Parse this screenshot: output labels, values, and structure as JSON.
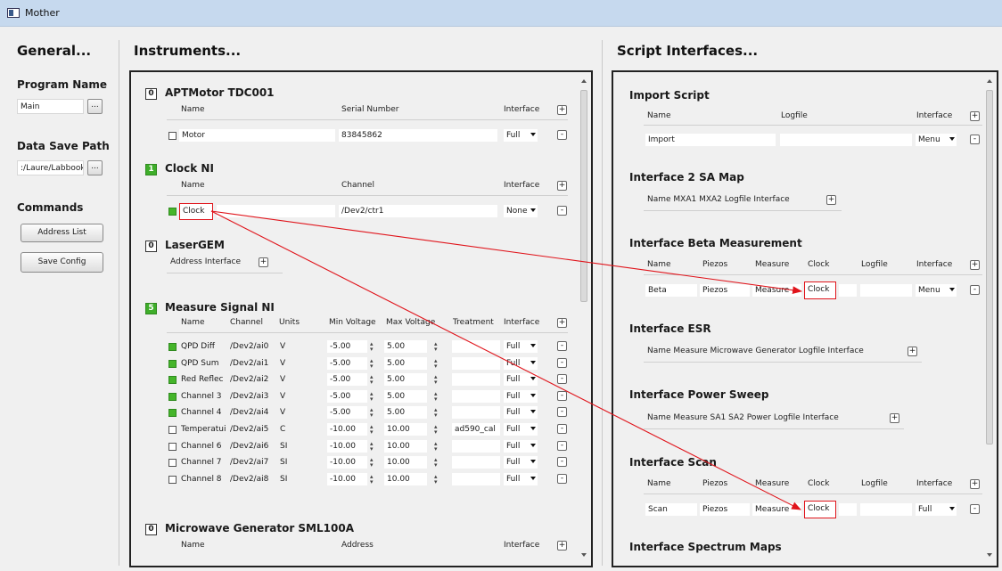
{
  "window": {
    "title": "Mother"
  },
  "general": {
    "heading": "General...",
    "program_name_label": "Program Name",
    "program_name_value": "Main",
    "data_save_path_label": "Data Save Path",
    "data_save_path_value": ":/Laure/Labbook",
    "browse_label": "...",
    "commands_label": "Commands",
    "address_list_label": "Address List",
    "save_config_label": "Save Config"
  },
  "instruments": {
    "heading": "Instruments...",
    "apt": {
      "badge": "0",
      "title": "APTMotor TDC001",
      "headers": [
        "Name",
        "Serial Number",
        "Interface"
      ],
      "row": {
        "name": "Motor",
        "serial": "83845862",
        "interface": "Full"
      }
    },
    "clock": {
      "badge": "1",
      "title": "Clock NI",
      "headers": [
        "Name",
        "Channel",
        "Interface"
      ],
      "row": {
        "name": "Clock",
        "channel": "/Dev2/ctr1",
        "interface": "None"
      }
    },
    "laser": {
      "badge": "0",
      "title": "LaserGEM",
      "headers": "Address Interface"
    },
    "measure": {
      "badge": "5",
      "title": "Measure Signal NI",
      "headers": [
        "Name",
        "Channel",
        "Units",
        "Min Voltage",
        "Max Voltage",
        "Treatment",
        "Interface"
      ],
      "rows": [
        {
          "name": "QPD Diff",
          "channel": "/Dev2/ai0",
          "units": "V",
          "min": "-5.00",
          "max": "5.00",
          "treatment": "",
          "interface": "Full",
          "checked": true
        },
        {
          "name": "QPD Sum",
          "channel": "/Dev2/ai1",
          "units": "V",
          "min": "-5.00",
          "max": "5.00",
          "treatment": "",
          "interface": "Full",
          "checked": true
        },
        {
          "name": "Red Reflec",
          "channel": "/Dev2/ai2",
          "units": "V",
          "min": "-5.00",
          "max": "5.00",
          "treatment": "",
          "interface": "Full",
          "checked": true
        },
        {
          "name": "Channel 3",
          "channel": "/Dev2/ai3",
          "units": "V",
          "min": "-5.00",
          "max": "5.00",
          "treatment": "",
          "interface": "Full",
          "checked": true
        },
        {
          "name": "Channel 4",
          "channel": "/Dev2/ai4",
          "units": "V",
          "min": "-5.00",
          "max": "5.00",
          "treatment": "",
          "interface": "Full",
          "checked": true
        },
        {
          "name": "Temperatui",
          "channel": "/Dev2/ai5",
          "units": "C",
          "min": "-10.00",
          "max": "10.00",
          "treatment": "ad590_cal",
          "interface": "Full",
          "checked": false
        },
        {
          "name": "Channel 6",
          "channel": "/Dev2/ai6",
          "units": "SI",
          "min": "-10.00",
          "max": "10.00",
          "treatment": "",
          "interface": "Full",
          "checked": false
        },
        {
          "name": "Channel 7",
          "channel": "/Dev2/ai7",
          "units": "SI",
          "min": "-10.00",
          "max": "10.00",
          "treatment": "",
          "interface": "Full",
          "checked": false
        },
        {
          "name": "Channel 8",
          "channel": "/Dev2/ai8",
          "units": "SI",
          "min": "-10.00",
          "max": "10.00",
          "treatment": "",
          "interface": "Full",
          "checked": false
        }
      ]
    },
    "microwave": {
      "badge": "0",
      "title": "Microwave Generator SML100A",
      "headers": [
        "Name",
        "Address",
        "Interface"
      ]
    }
  },
  "scripts": {
    "heading": "Script Interfaces...",
    "import": {
      "title": "Import Script",
      "headers": [
        "Name",
        "Logfile",
        "Interface"
      ],
      "row": {
        "name": "Import",
        "logfile": "",
        "interface": "Menu"
      }
    },
    "sa_map": {
      "title": "Interface 2 SA Map",
      "headers": "Name MXA1 MXA2 Logfile Interface"
    },
    "beta": {
      "title": "Interface Beta Measurement",
      "headers": [
        "Name",
        "Piezos",
        "Measure",
        "Clock",
        "Logfile",
        "Interface"
      ],
      "row": {
        "name": "Beta",
        "piezos": "Piezos",
        "measure": "Measure",
        "clock": "Clock",
        "logfile": "",
        "interface": "Menu"
      }
    },
    "esr": {
      "title": "Interface ESR",
      "headers": "Name Measure Microwave Generator Logfile Interface"
    },
    "power": {
      "title": "Interface Power Sweep",
      "headers": "Name Measure SA1 SA2 Power Logfile Interface"
    },
    "scan": {
      "title": "Interface Scan",
      "headers": [
        "Name",
        "Piezos",
        "Measure",
        "Clock",
        "Logfile",
        "Interface"
      ],
      "row": {
        "name": "Scan",
        "piezos": "Piezos",
        "measure": "Measure",
        "clock": "Clock",
        "logfile": "",
        "interface": "Full"
      }
    },
    "spectrum": {
      "title": "Interface Spectrum Maps"
    }
  },
  "colors": {
    "green": "#3fae2a",
    "annotation_red": "#e0141b",
    "titlebar": "#c6d9ee"
  }
}
